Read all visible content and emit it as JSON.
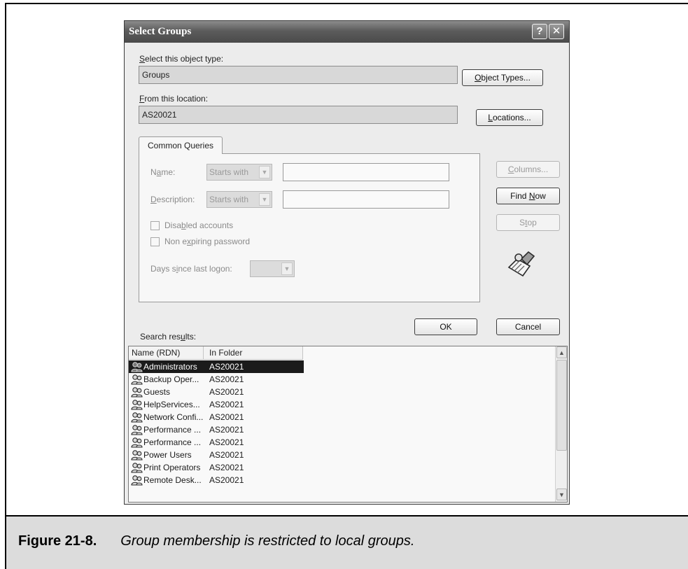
{
  "dialog": {
    "title": "Select Groups",
    "help_glyph": "?",
    "close_glyph": "✕"
  },
  "object_type": {
    "label_key": "S",
    "label_rest": "elect this object type:",
    "value": "Groups",
    "button_key": "O",
    "button_rest": "bject Types..."
  },
  "location": {
    "label_key": "F",
    "label_rest": "rom this location:",
    "value": "AS20021",
    "button_key": "L",
    "button_rest": "ocations..."
  },
  "queries": {
    "tab_label": "Common Queries",
    "name_label_pre": "N",
    "name_label_key": "a",
    "name_label_post": "me:",
    "name_mode": "Starts with",
    "desc_label_key": "D",
    "desc_label_rest": "escription:",
    "desc_mode": "Starts with",
    "disabled_pre": "Disa",
    "disabled_key": "b",
    "disabled_post": "led accounts",
    "nonexp_pre": "Non e",
    "nonexp_key": "x",
    "nonexp_post": "piring password",
    "days_pre": "Days s",
    "days_key": "i",
    "days_post": "nce last logon:"
  },
  "side_buttons": {
    "columns_key": "C",
    "columns_rest": "olumns...",
    "find_pre": "Find ",
    "find_key": "N",
    "find_post": "ow",
    "stop_pre": "S",
    "stop_key": "t",
    "stop_post": "op"
  },
  "actions": {
    "ok": "OK",
    "cancel": "Cancel"
  },
  "results": {
    "label_pre": "Search res",
    "label_key": "u",
    "label_post": "lts:",
    "columns": [
      "Name (RDN)",
      "In Folder"
    ],
    "rows": [
      {
        "name": "Administrators",
        "folder": "AS20021",
        "selected": true
      },
      {
        "name": "Backup Oper...",
        "folder": "AS20021"
      },
      {
        "name": "Guests",
        "folder": "AS20021"
      },
      {
        "name": "HelpServices...",
        "folder": "AS20021"
      },
      {
        "name": "Network Confi...",
        "folder": "AS20021"
      },
      {
        "name": "Performance ...",
        "folder": "AS20021"
      },
      {
        "name": "Performance ...",
        "folder": "AS20021"
      },
      {
        "name": "Power Users",
        "folder": "AS20021"
      },
      {
        "name": "Print Operators",
        "folder": "AS20021"
      },
      {
        "name": "Remote Desk...",
        "folder": "AS20021"
      }
    ]
  },
  "caption": {
    "label": "Figure 21-8.",
    "text": "Group membership is restricted to local groups."
  },
  "icons": {
    "row_icon": "group-icon",
    "search_art": "search-flashlight-icon"
  }
}
